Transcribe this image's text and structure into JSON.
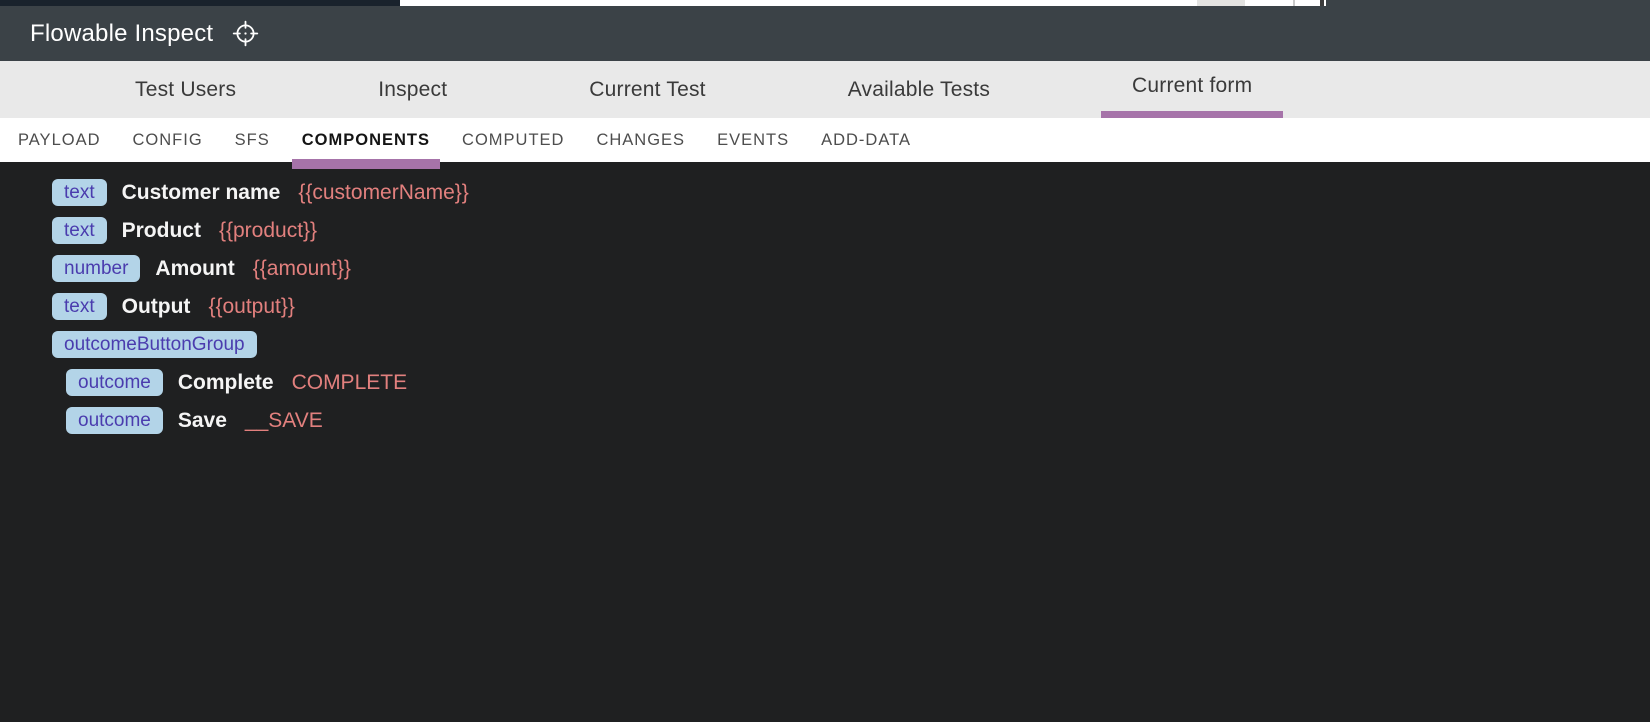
{
  "header": {
    "title": "Flowable Inspect",
    "icon": "crosshair-icon"
  },
  "main_tabs": {
    "active_index": 4,
    "items": [
      {
        "label": "Test Users"
      },
      {
        "label": "Inspect"
      },
      {
        "label": "Current Test"
      },
      {
        "label": "Available Tests"
      },
      {
        "label": "Current form"
      }
    ]
  },
  "sub_tabs": {
    "active_index": 3,
    "items": [
      {
        "label": "PAYLOAD"
      },
      {
        "label": "CONFIG"
      },
      {
        "label": "SFS"
      },
      {
        "label": "COMPONENTS"
      },
      {
        "label": "COMPUTED"
      },
      {
        "label": "CHANGES"
      },
      {
        "label": "EVENTS"
      },
      {
        "label": "ADD-DATA"
      }
    ]
  },
  "components": [
    {
      "type": "text",
      "label": "Customer name",
      "binding": "{{customerName}}",
      "indent": 0
    },
    {
      "type": "text",
      "label": "Product",
      "binding": "{{product}}",
      "indent": 0
    },
    {
      "type": "number",
      "label": "Amount",
      "binding": "{{amount}}",
      "indent": 0
    },
    {
      "type": "text",
      "label": "Output",
      "binding": "{{output}}",
      "indent": 0
    },
    {
      "type": "outcomeButtonGroup",
      "label": "",
      "binding": "",
      "indent": 0
    },
    {
      "type": "outcome",
      "label": "Complete",
      "binding": "COMPLETE",
      "indent": 1
    },
    {
      "type": "outcome",
      "label": "Save",
      "binding": "__SAVE",
      "indent": 1
    }
  ],
  "colors": {
    "accent_purple": "#a673a9",
    "header_bg": "#3b4247",
    "tabbar_bg": "#e9e9e9",
    "content_bg": "#1f2021",
    "badge_bg": "#b3d4e8",
    "badge_text": "#4a3cae",
    "value_text": "#e2807e"
  }
}
